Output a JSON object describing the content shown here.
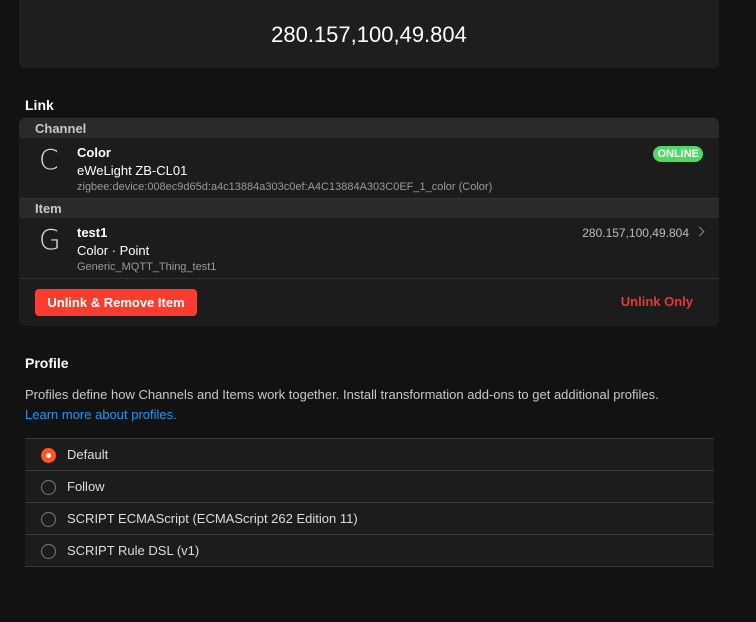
{
  "state": {
    "value": "280.157,100,49.804"
  },
  "link": {
    "section_title": "Link",
    "channel": {
      "header": "Channel",
      "letter": "C",
      "title": "Color",
      "subtitle": "eWeLight ZB-CL01",
      "footer": "zigbee:device:008ec9d65d:a4c13884a303c0ef:A4C13884A303C0EF_1_color (Color)",
      "status": "ONLINE",
      "status_color": "#4cd964"
    },
    "item": {
      "header": "Item",
      "letter": "G",
      "title": "test1",
      "subtitle": "Color · Point",
      "footer": "Generic_MQTT_Thing_test1",
      "after": "280.157,100,49.804"
    },
    "unlink_remove_label": "Unlink & Remove Item",
    "unlink_only_label": "Unlink Only"
  },
  "profile": {
    "section_title": "Profile",
    "description": "Profiles define how Channels and Items work together. Install transformation add-ons to get additional profiles.",
    "learn_more": "Learn more about profiles.",
    "options": [
      {
        "label": "Default",
        "selected": true
      },
      {
        "label": "Follow",
        "selected": false
      },
      {
        "label": "SCRIPT ECMAScript (ECMAScript 262 Edition 11)",
        "selected": false
      },
      {
        "label": "SCRIPT Rule DSL (v1)",
        "selected": false
      }
    ]
  },
  "colors": {
    "accent": "#ff5722",
    "danger": "#ff3b30",
    "link": "#2196f3"
  }
}
